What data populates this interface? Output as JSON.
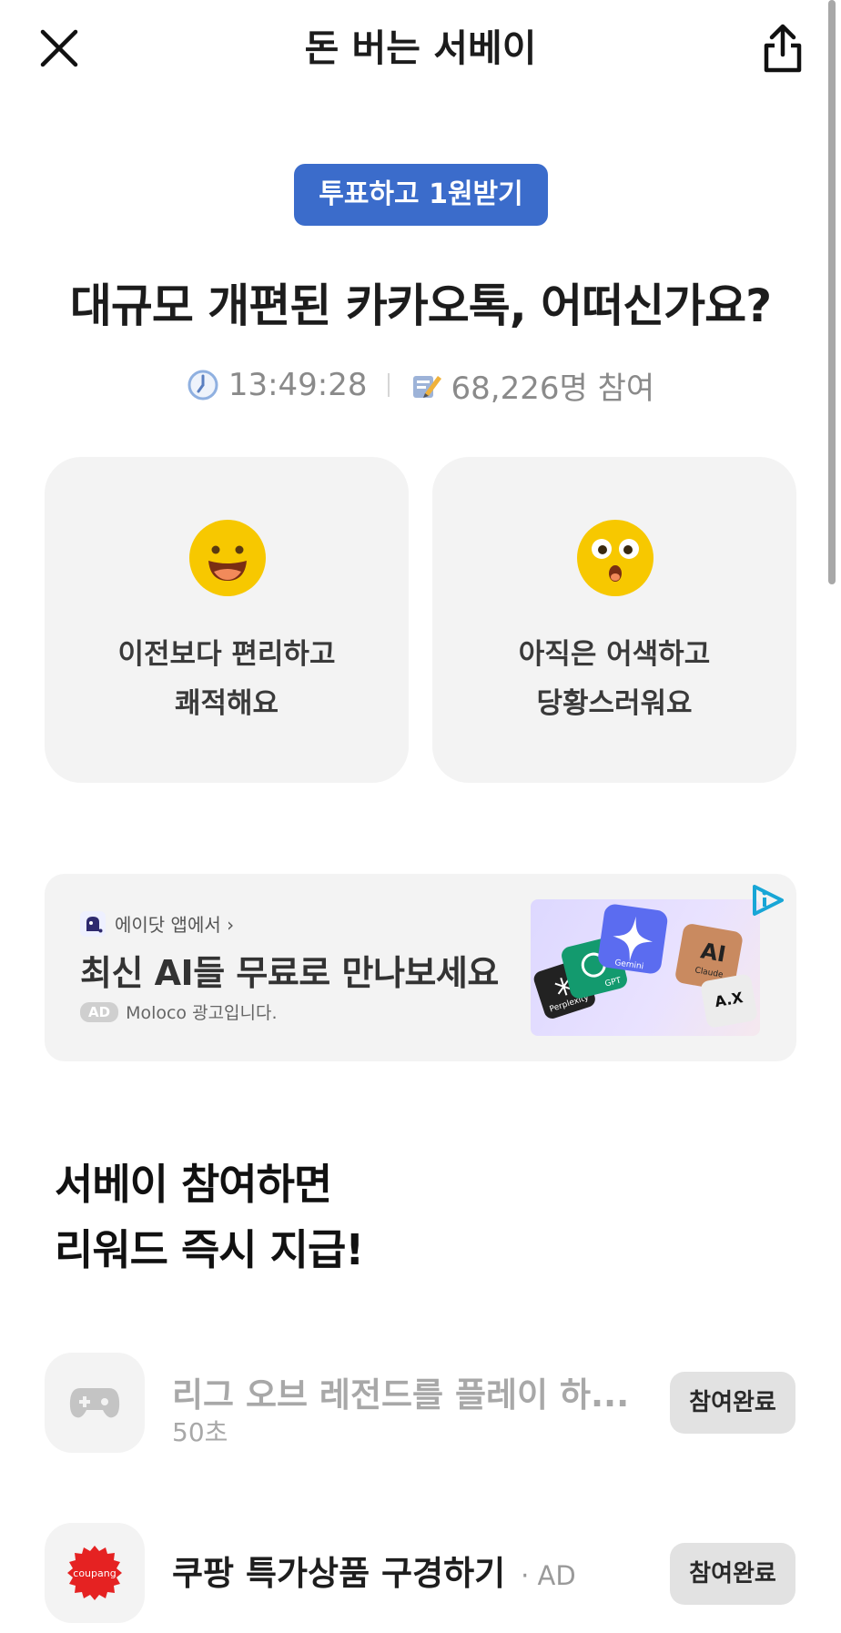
{
  "header": {
    "title": "돈 버는 서베이",
    "close_icon": "close-icon",
    "share_icon": "share-icon"
  },
  "survey": {
    "badge": "투표하고 1원받기",
    "question": "대규모 개편된 카카오톡, 어떠신가요?",
    "time_left": "13:49:28",
    "participants": "68,226명 참여",
    "options": [
      {
        "label": "이전보다 편리하고\n쾌적해요",
        "emoji": "smiling-face-icon"
      },
      {
        "label": "아직은 어색하고\n당황스러워요",
        "emoji": "surprised-face-icon"
      }
    ]
  },
  "ad_banner": {
    "source": "에이닷 앱에서 ›",
    "headline": "최신 AI들 무료로 만나보세요",
    "chip": "AD",
    "note": "Moloco 광고입니다.",
    "thumb_labels": [
      "Perplexity",
      "GPT",
      "Gemini",
      "Claude",
      "A.X"
    ]
  },
  "reward_section": {
    "heading": "서베이 참여하면\n리워드 즉시 지급!"
  },
  "missions": [
    {
      "title": "리그 오브 레전드를 플레이 하...",
      "sub": "50초",
      "button": "참여완료",
      "icon": "gamepad-icon"
    },
    {
      "title": "쿠팡 특가상품 구경하기",
      "suffix": "· AD",
      "button": "참여완료",
      "icon": "coupang-logo-icon",
      "logo_text": "coupang"
    }
  ],
  "colors": {
    "accent": "#3b6ccb",
    "card_bg": "#f3f3f3",
    "emoji_yellow": "#f7c800",
    "coupang_red": "#e52222"
  }
}
